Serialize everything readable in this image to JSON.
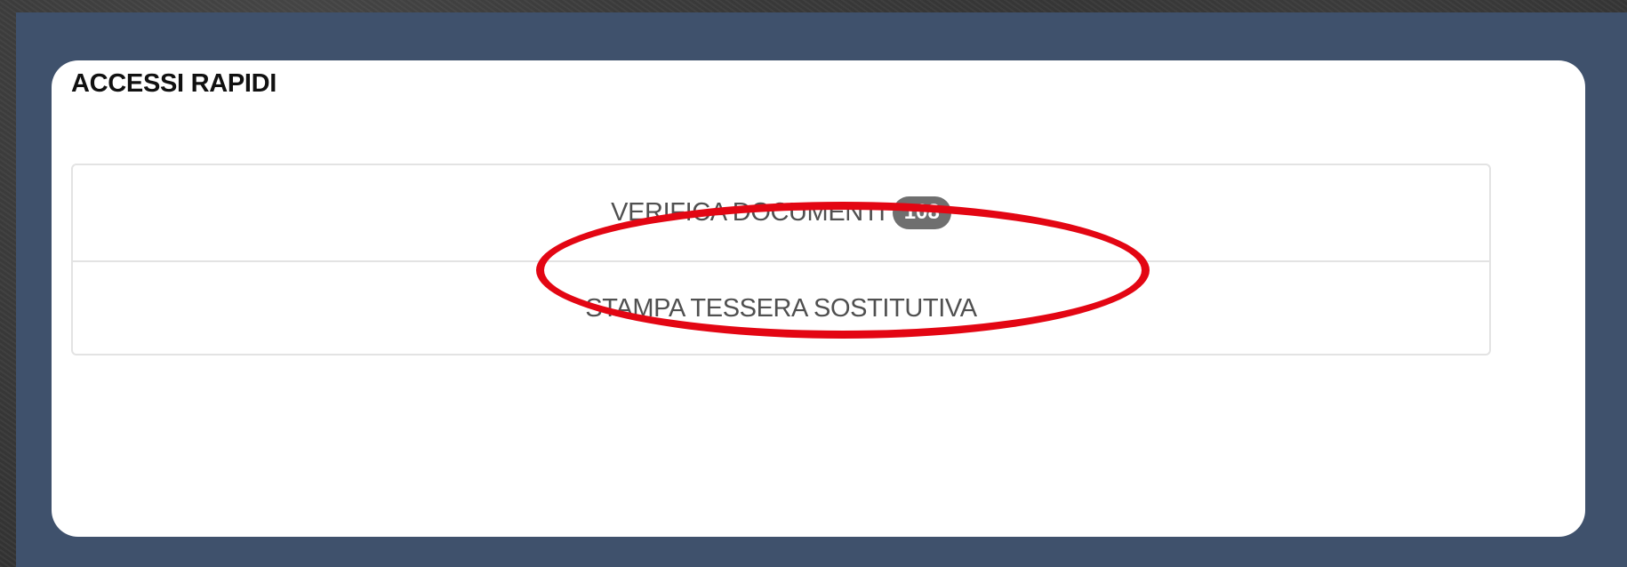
{
  "quick_access": {
    "title": "ACCESSI RAPIDI",
    "links": [
      {
        "label": "VERIFICA DOCUMENTI",
        "badge": "108"
      },
      {
        "label": "STAMPA TESSERA SOSTITUTIVA"
      }
    ]
  },
  "colors": {
    "panel_background": "#3f516c",
    "card_background": "#ffffff",
    "badge_background": "#6f6f6f",
    "highlight_annotation": "#e30613"
  }
}
